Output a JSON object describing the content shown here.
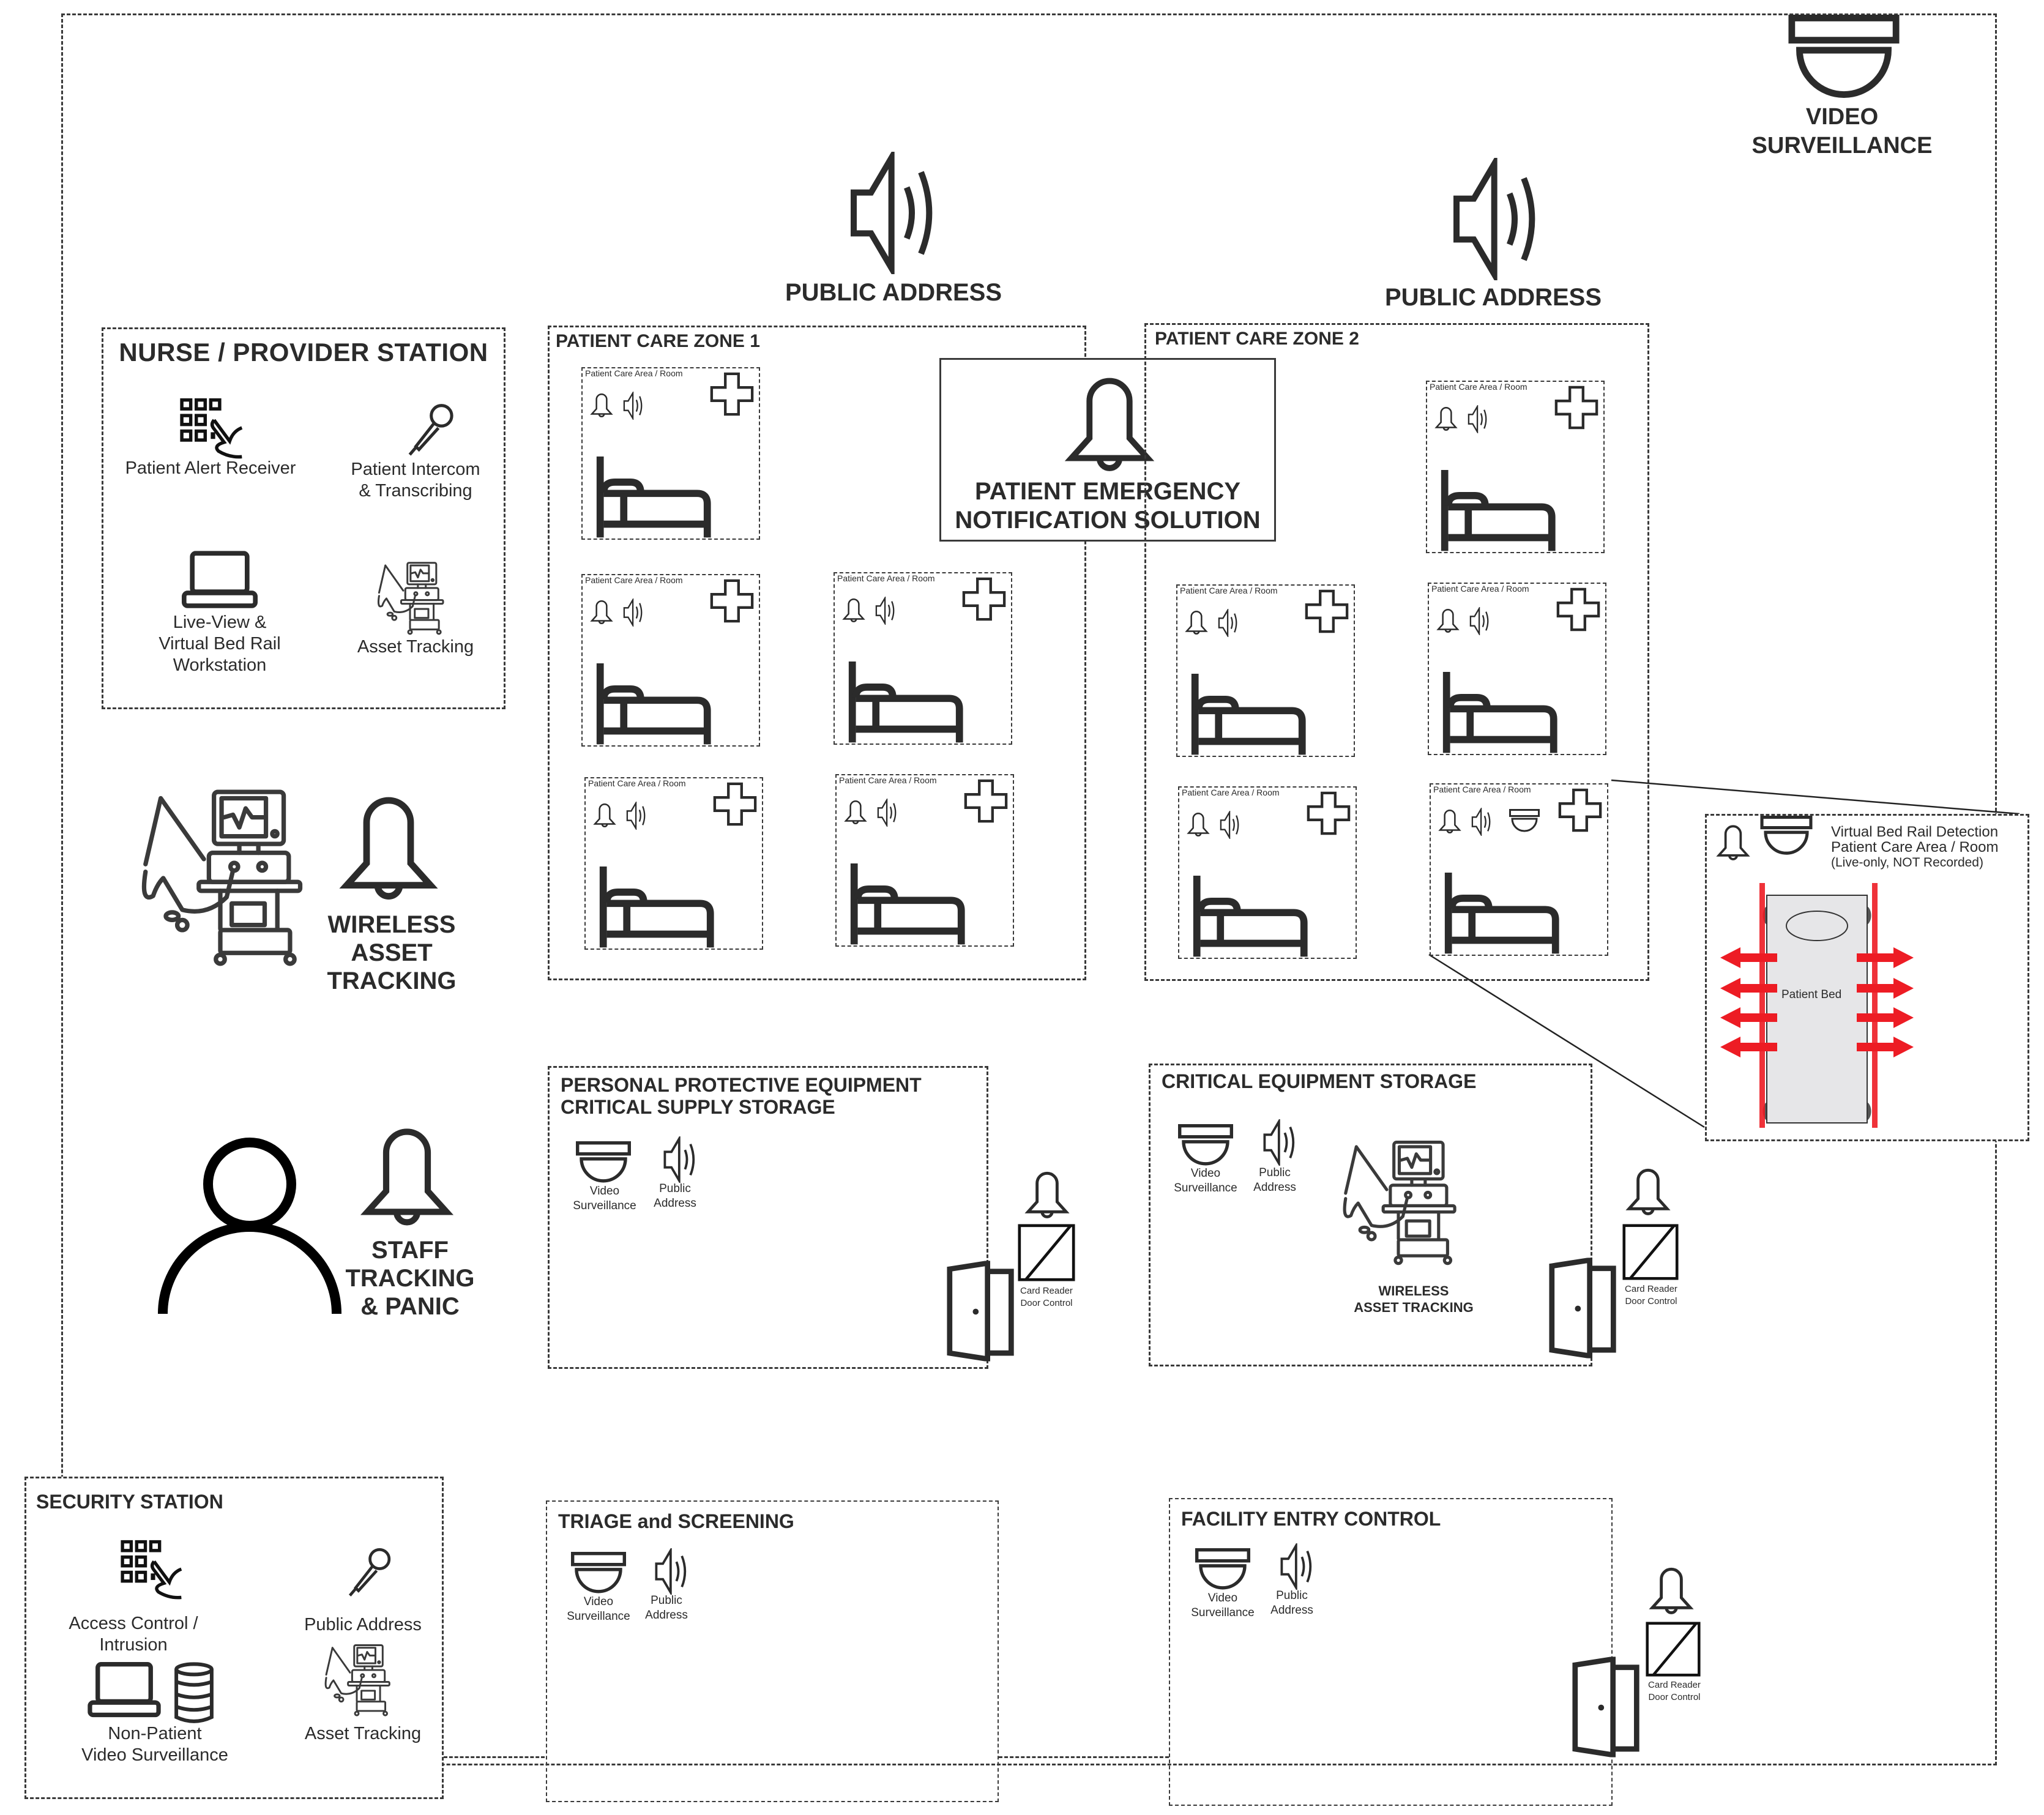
{
  "diagram": {
    "top_right": {
      "icon": "dome-camera-icon",
      "label_line1": "VIDEO",
      "label_line2": "SURVEILLANCE"
    },
    "public_address_1": {
      "icon": "speaker-icon",
      "label": "PUBLIC ADDRESS"
    },
    "public_address_2": {
      "icon": "speaker-icon",
      "label": "PUBLIC ADDRESS"
    },
    "nurse_station": {
      "title": "NURSE / PROVIDER STATION",
      "items": [
        {
          "icon": "keypad-touch-icon",
          "label_line1": "Patient Alert Receiver",
          "label_line2": ""
        },
        {
          "icon": "microphone-icon",
          "label_line1": "Patient Intercom",
          "label_line2": "& Transcribing"
        },
        {
          "icon": "laptop-icon",
          "label_line1": "Live-View &",
          "label_line2": "Virtual Bed Rail",
          "label_line3": "Workstation"
        },
        {
          "icon": "ventilator-icon",
          "label_line1": "Asset Tracking",
          "label_line2": ""
        }
      ]
    },
    "zone1": {
      "title": "PATIENT CARE ZONE 1",
      "rooms": [
        {
          "label": "Patient Care Area / Room"
        },
        {
          "label": "Patient Care Area / Room"
        },
        {
          "label": "Patient Care Area / Room"
        },
        {
          "label": "Patient Care Area / Room"
        },
        {
          "label": "Patient Care Area / Room"
        }
      ]
    },
    "zone2": {
      "title": "PATIENT CARE ZONE 2",
      "rooms": [
        {
          "label": "Patient Care Area / Room"
        },
        {
          "label": "Patient Care Area / Room"
        },
        {
          "label": "Patient Care Area / Room"
        },
        {
          "label": "Patient Care Area / Room"
        },
        {
          "label": "Patient Care Area / Room",
          "has_camera": true
        }
      ]
    },
    "emergency": {
      "icon": "bell-icon",
      "line1": "PATIENT EMERGENCY",
      "line2": "NOTIFICATION SOLUTION"
    },
    "wireless_asset": {
      "line1": "WIRELESS",
      "line2": "ASSET",
      "line3": "TRACKING"
    },
    "staff_tracking": {
      "line1": "STAFF",
      "line2": "TRACKING",
      "line3": "& PANIC"
    },
    "bed_rail_detail": {
      "line1": "Virtual Bed Rail Detection",
      "line2": "Patient Care Area / Room",
      "line3": "(Live-only, NOT Recorded)",
      "bed_label": "Patient Bed",
      "alert_color": "#ed1c24",
      "bed_fill": "#e6e6e8"
    },
    "ppe_storage": {
      "title_line1": "PERSONAL PROTECTIVE EQUIPMENT",
      "title_line2": "CRITICAL SUPPLY STORAGE",
      "video_line1": "Video",
      "video_line2": "Surveillance",
      "pa_line1": "Public",
      "pa_line2": "Address",
      "card_line1": "Card Reader",
      "card_line2": "Door Control"
    },
    "critical_storage": {
      "title": "CRITICAL EQUIPMENT STORAGE",
      "video_line1": "Video",
      "video_line2": "Surveillance",
      "pa_line1": "Public",
      "pa_line2": "Address",
      "asset_line1": "WIRELESS",
      "asset_line2": "ASSET TRACKING",
      "card_line1": "Card Reader",
      "card_line2": "Door Control"
    },
    "security_station": {
      "title": "SECURITY STATION",
      "items": [
        {
          "icon": "keypad-touch-icon",
          "label_line1": "Access Control / Intrusion",
          "label_line2": ""
        },
        {
          "icon": "microphone-icon",
          "label_line1": "Public Address",
          "label_line2": ""
        },
        {
          "icon": "laptop-database-icon",
          "label_line1": "Non-Patient",
          "label_line2": "Video Surveillance"
        },
        {
          "icon": "ventilator-icon",
          "label_line1": "Asset Tracking",
          "label_line2": ""
        }
      ]
    },
    "triage": {
      "title": "TRIAGE and SCREENING",
      "video_line1": "Video",
      "video_line2": "Surveillance",
      "pa_line1": "Public",
      "pa_line2": "Address"
    },
    "entry_control": {
      "title": "FACILITY ENTRY CONTROL",
      "video_line1": "Video",
      "video_line2": "Surveillance",
      "pa_line1": "Public",
      "pa_line2": "Address",
      "card_line1": "Card Reader",
      "card_line2": "Door Control"
    }
  }
}
